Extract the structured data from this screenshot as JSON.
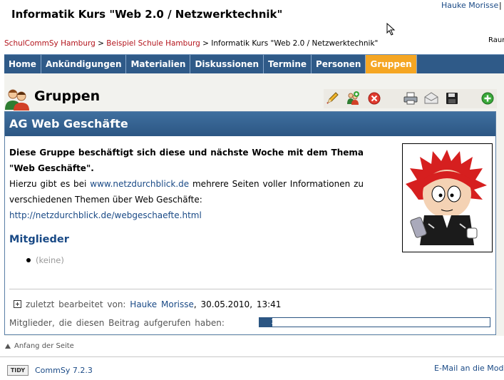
{
  "header": {
    "title": "Informatik Kurs \"Web 2.0 / Netzwerktechnik\"",
    "user": "Hauke Morisse",
    "separator": "|",
    "right_cut": "Raur"
  },
  "breadcrumb": {
    "items": [
      "SchulCommSy Hamburg",
      "Beispiel Schule Hamburg",
      "Informatik Kurs \"Web 2.0 / Netzwerktechnik\""
    ],
    "separator": ">"
  },
  "nav": {
    "tabs": [
      {
        "label": "Home"
      },
      {
        "label": "Ankündigungen"
      },
      {
        "label": "Materialien"
      },
      {
        "label": "Diskussionen"
      },
      {
        "label": "Termine"
      },
      {
        "label": "Personen"
      },
      {
        "label": "Gruppen",
        "active": true
      }
    ]
  },
  "section": {
    "title": "Gruppen",
    "actions": [
      "edit-icon",
      "add-member-icon",
      "delete-icon",
      "print-icon",
      "mail-icon",
      "save-icon",
      "add-icon"
    ]
  },
  "item": {
    "title": "AG Web Geschäfte",
    "desc_bold": "Diese Gruppe beschäftigt sich diese und nächste Woche mit dem Thema \"Web Geschäfte\".",
    "desc_text1": "Hierzu gibt es bei ",
    "desc_link1": "www.netzdurchblick.de",
    "desc_text2": " mehrere Seiten voller Informationen zu verschiedenen Themen über Web Geschäfte:",
    "desc_link2": "http://netzdurchblick.de/webgeschaefte.html",
    "members_heading": "Mitglieder",
    "members_none": "(keine)",
    "last_edit_label": "zuletzt bearbeitet von:",
    "last_edit_user": "Hauke Morisse",
    "last_edit_date": ", 30.05.2010, 13:41",
    "views_label": "Mitglieder, die diesen Beitrag aufgerufen haben:",
    "views_value": "1",
    "views_fraction": 0.055
  },
  "footer": {
    "top_link": "Anfang der Seite",
    "tidy": "TIDY",
    "version": "CommSy 7.2.3",
    "email": "E-Mail an die Mode"
  },
  "colors": {
    "nav_bg": "#2f5a88",
    "active_tab": "#f5a623",
    "link": "#1a4a86",
    "crumb_link": "#b3141c"
  }
}
